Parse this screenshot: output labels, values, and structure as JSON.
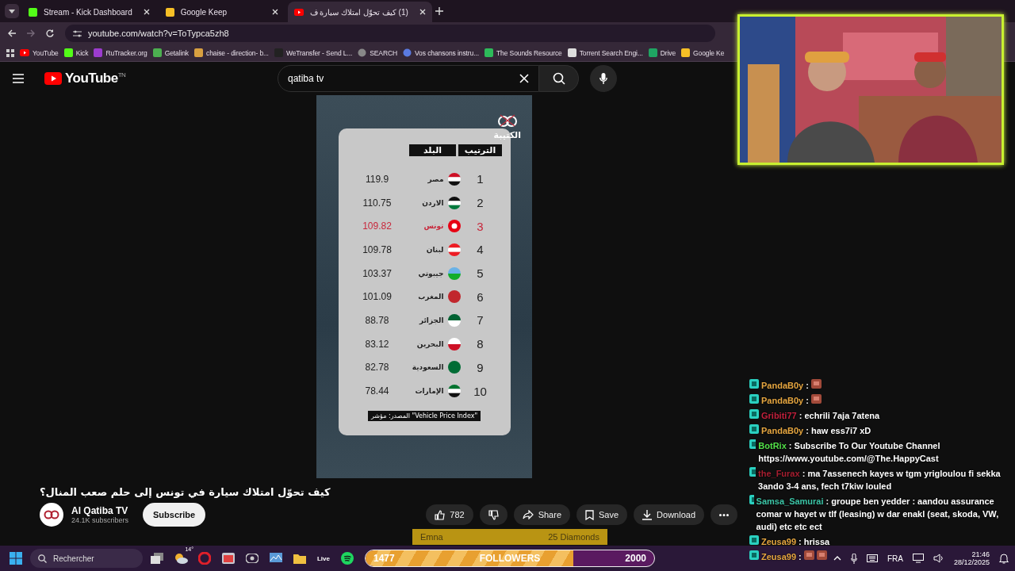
{
  "browser": {
    "tabs": [
      {
        "title": "Stream - Kick Dashboard",
        "kind": "kick",
        "selected": false
      },
      {
        "title": "Google Keep",
        "kind": "keep",
        "selected": false
      },
      {
        "title": "(1) كيف تحوّل امتلاك سيارة ف",
        "kind": "youtube",
        "selected": true
      }
    ],
    "address": "youtube.com/watch?v=ToTypca5zh8",
    "bookmarks": [
      {
        "label": "YouTube",
        "kind": "youtube"
      },
      {
        "label": "Kick",
        "kind": "kick"
      },
      {
        "label": "RuTracker.org",
        "kind": "rutracker"
      },
      {
        "label": "Getalink",
        "kind": "getalink"
      },
      {
        "label": "chaise - direction- b...",
        "kind": "chaise"
      },
      {
        "label": "WeTransfer - Send L...",
        "kind": "wetransfer"
      },
      {
        "label": "SEARCH",
        "kind": "search"
      },
      {
        "label": "Vos chansons instru...",
        "kind": "vos"
      },
      {
        "label": "The Sounds Resource",
        "kind": "sounds"
      },
      {
        "label": "Torrent Search Engi...",
        "kind": "torrent"
      },
      {
        "label": "Drive",
        "kind": "drive"
      },
      {
        "label": "Google Ke",
        "kind": "keep"
      }
    ]
  },
  "youtube": {
    "logo": "YouTube",
    "region": "TN",
    "search": {
      "value": "qatiba tv"
    },
    "video": {
      "logo": "الكتيبة",
      "header_rank": "الترتيب",
      "header_country": "البلد",
      "rows": [
        {
          "rank": "1",
          "country": "مصر",
          "value": "119.9",
          "kind": "egypt",
          "highlighted": false
        },
        {
          "rank": "2",
          "country": "الاردن",
          "value": "110.75",
          "kind": "jordan",
          "highlighted": false
        },
        {
          "rank": "3",
          "country": "تونس",
          "value": "109.82",
          "kind": "tunisia",
          "highlighted": true
        },
        {
          "rank": "4",
          "country": "لبنان",
          "value": "109.78",
          "kind": "lebanon",
          "highlighted": false
        },
        {
          "rank": "5",
          "country": "جيبوتي",
          "value": "103.37",
          "kind": "djibouti",
          "highlighted": false
        },
        {
          "rank": "6",
          "country": "المغرب",
          "value": "101.09",
          "kind": "morocco",
          "highlighted": false
        },
        {
          "rank": "7",
          "country": "الجزائر",
          "value": "88.78",
          "kind": "algeria",
          "highlighted": false
        },
        {
          "rank": "8",
          "country": "البحرين",
          "value": "83.12",
          "kind": "bahrain",
          "highlighted": false
        },
        {
          "rank": "9",
          "country": "السعودية",
          "value": "82.78",
          "kind": "saudi",
          "highlighted": false
        },
        {
          "rank": "10",
          "country": "الإمارات",
          "value": "78.44",
          "kind": "uae",
          "highlighted": false
        }
      ],
      "source": "المصدر: مؤشر \"Vehicle Price Index\""
    },
    "title": "كيف تحوّل امتلاك سيارة في تونس إلى حلم صعب المنال؟",
    "channel": {
      "name": "Al Qatiba TV",
      "subscribers": "24.1K subscribers",
      "subscribe": "Subscribe"
    },
    "likes": "782",
    "share": "Share",
    "save": "Save",
    "download": "Download"
  },
  "alert": {
    "name": "Emna",
    "amount": "25 Diamonds"
  },
  "chat": [
    {
      "user": "PandaB0y",
      "color": "#e6a640",
      "kind": "emote",
      "text": ":"
    },
    {
      "user": "PandaB0y",
      "color": "#e6a640",
      "kind": "emote",
      "text": ":"
    },
    {
      "user": "Gribiti77",
      "color": "#c4203c",
      "kind": "text",
      "text": ": echrili 7aja 7atena"
    },
    {
      "user": "PandaB0y",
      "color": "#e6a640",
      "kind": "text",
      "text": ": haw ess7i7 xD"
    },
    {
      "user": "BotRix",
      "color": "#52e048",
      "kind": "text",
      "text": ": Subscribe To Our Youtube Channel https://www.youtube.com/@The.HappyCast"
    },
    {
      "user": "the_Furax",
      "color": "#a61e30",
      "kind": "text",
      "text": ": ma 7assenech kayes w tgm yrigloulou fi sekka 3ando 3-4 ans, fech t7kiw louled"
    },
    {
      "user": "Samsa_Samurai",
      "color": "#3cc4a6",
      "kind": "text",
      "text": ": groupe ben yedder : aandou assurance comar w hayet w tlf (leasing) w dar enakl (seat, skoda, VW, audi) etc etc ect"
    },
    {
      "user": "Zeusa99",
      "color": "#e6a640",
      "kind": "text",
      "text": ": hrissa"
    },
    {
      "user": "Zeusa99",
      "color": "#e6a640",
      "kind": "emotes",
      "text": ":"
    }
  ],
  "taskbar": {
    "search": {
      "placeholder": "Rechercher"
    },
    "weather": "14°",
    "live": "Live",
    "followers": {
      "current": "1477",
      "label": "FOLLOWERS",
      "goal": "2000",
      "level": 0.72
    },
    "language": "FRA",
    "time": "21:46",
    "date": "28/12/2025"
  }
}
